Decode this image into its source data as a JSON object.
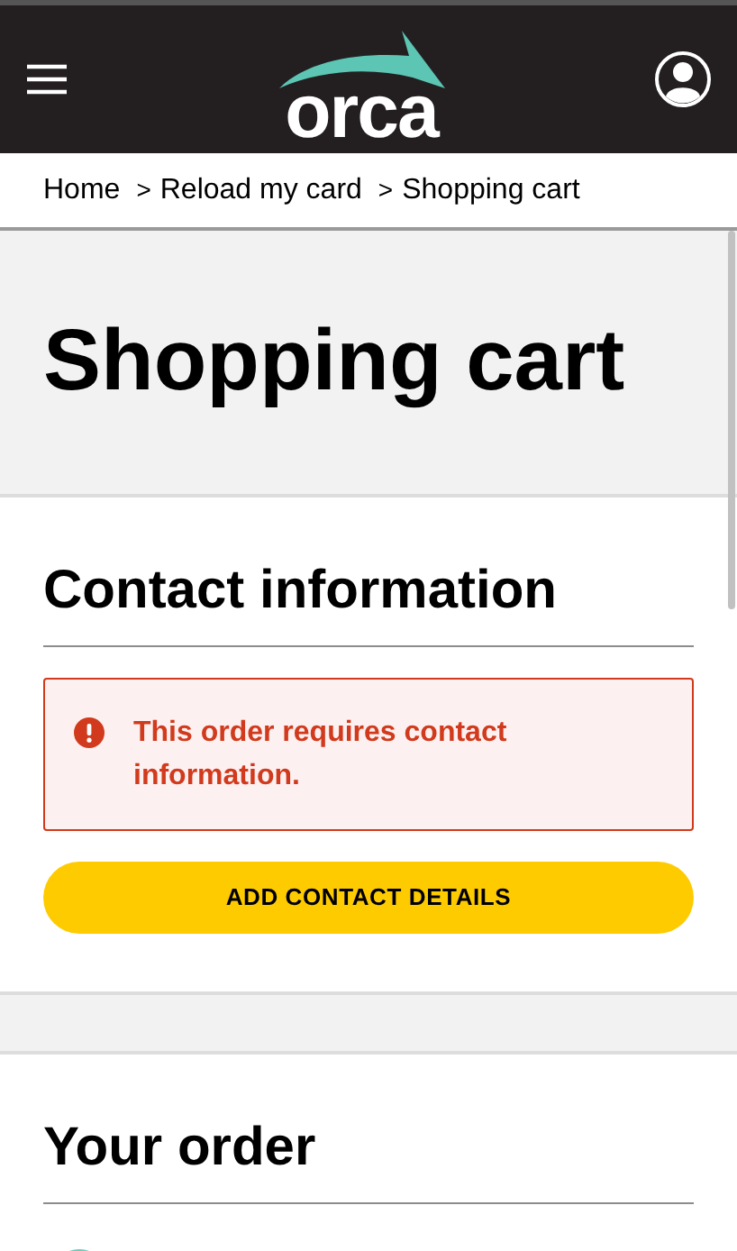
{
  "header": {
    "logo": "orca"
  },
  "breadcrumb": [
    {
      "label": "Home"
    },
    {
      "label": "Reload my card",
      "separator": ">"
    },
    {
      "label": "Shopping cart",
      "separator": ">"
    }
  ],
  "page_title": "Shopping cart",
  "contact_section": {
    "heading": "Contact information",
    "alert": {
      "text": "This order requires contact information."
    },
    "button": "ADD CONTACT DETAILS"
  },
  "order_section": {
    "heading": "Your order"
  }
}
